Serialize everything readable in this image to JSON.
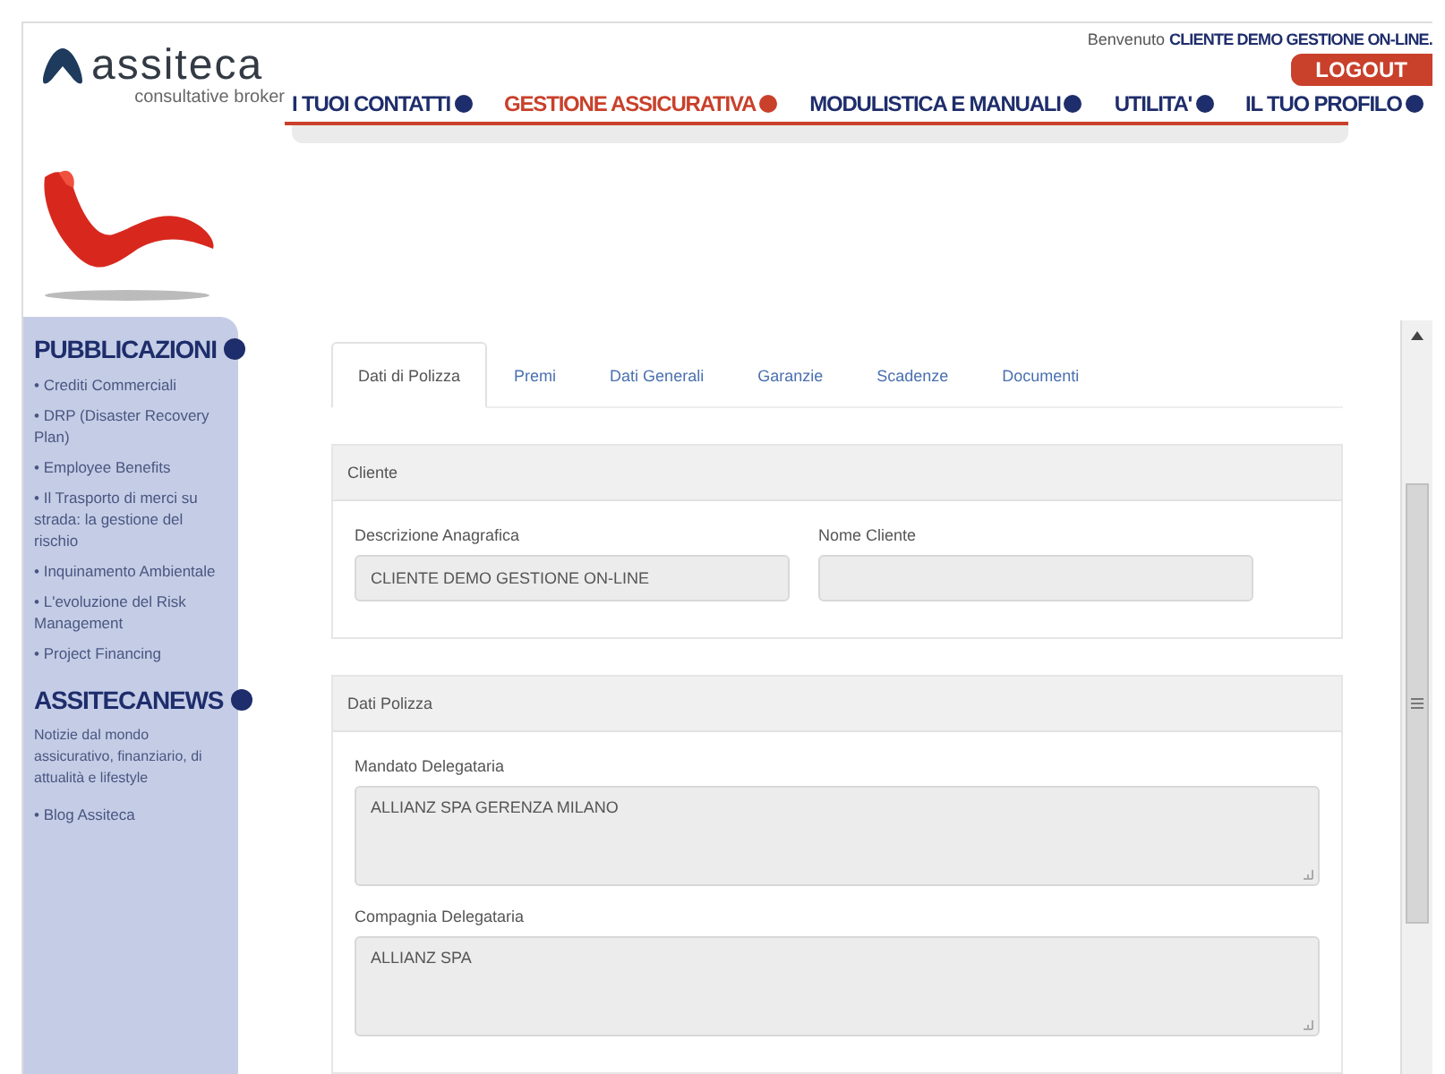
{
  "header": {
    "logo": {
      "name": "assiteca",
      "tagline": "consultative broker"
    },
    "welcome": {
      "label": "Benvenuto",
      "user": "CLIENTE DEMO GESTIONE ON-LINE."
    },
    "logout": "LOGOUT"
  },
  "nav": [
    {
      "label": "I TUOI CONTATTI",
      "selected": false
    },
    {
      "label": "GESTIONE ASSICURATIVA",
      "selected": true
    },
    {
      "label": "MODULISTICA E MANUALI",
      "selected": false
    },
    {
      "label": "UTILITA'",
      "selected": false
    },
    {
      "label": "IL TUO PROFILO",
      "selected": false
    }
  ],
  "sidebar": [
    {
      "title": "PUBBLICAZIONI",
      "items": [
        "• Crediti Commerciali",
        "• DRP (Disaster Recovery Plan)",
        "• Employee Benefits",
        "• Il Trasporto di merci su strada: la gestione del rischio",
        "• Inquinamento Ambientale",
        "• L'evoluzione del Risk Management",
        "• Project Financing"
      ]
    },
    {
      "title": "ASSITECANEWS",
      "text": "Notizie dal mondo assicurativo, finanziario, di attualità e lifestyle",
      "items": [
        "• Blog Assiteca"
      ]
    }
  ],
  "tabs": [
    {
      "label": "Dati di Polizza",
      "selected": true
    },
    {
      "label": "Premi",
      "selected": false
    },
    {
      "label": "Dati Generali",
      "selected": false
    },
    {
      "label": "Garanzie",
      "selected": false
    },
    {
      "label": "Scadenze",
      "selected": false
    },
    {
      "label": "Documenti",
      "selected": false
    }
  ],
  "panels": [
    {
      "title": "Cliente",
      "fields": [
        {
          "kind": "input",
          "label": "Descrizione Anagrafica",
          "value": "CLIENTE DEMO GESTIONE ON-LINE"
        },
        {
          "kind": "input",
          "label": "Nome Cliente"
        }
      ]
    },
    {
      "title": "Dati Polizza",
      "fields": [
        {
          "kind": "textarea",
          "label": "Mandato Delegataria",
          "value": "ALLIANZ SPA GERENZA MILANO"
        },
        {
          "kind": "textarea",
          "label": "Compagnia Delegataria",
          "value": "ALLIANZ SPA"
        }
      ]
    }
  ]
}
